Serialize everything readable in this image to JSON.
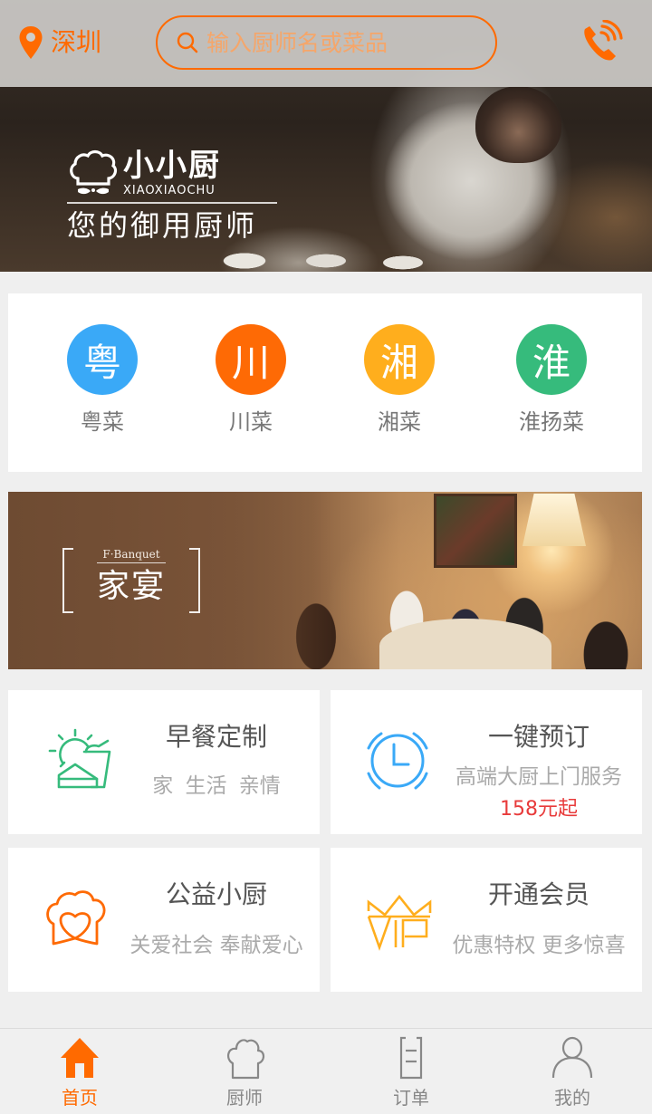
{
  "header": {
    "city": "深圳",
    "search_placeholder": "输入厨师名或菜品",
    "accent_color": "#ff6a00",
    "icons": {
      "location": "location-pin-icon",
      "search": "search-icon",
      "phone": "phone-icon"
    }
  },
  "hero": {
    "brand_name": "小小厨",
    "brand_pinyin": "XIAOXIAOCHU",
    "tagline": "您的御用厨师"
  },
  "cuisines": [
    {
      "char": "粤",
      "label": "粤菜",
      "color": "#3aa9f7"
    },
    {
      "char": "川",
      "label": "川菜",
      "color": "#fe6a05"
    },
    {
      "char": "湘",
      "label": "湘菜",
      "color": "#ffae1d"
    },
    {
      "char": "淮",
      "label": "淮扬菜",
      "color": "#36bb7c"
    }
  ],
  "banquet": {
    "en_label": "F·Banquet",
    "cn_label": "家宴"
  },
  "services": [
    {
      "title": "早餐定制",
      "subtitle": "家  生活  亲情",
      "icon": "breakfast-icon",
      "color": "#36bb7c"
    },
    {
      "title": "一键预订",
      "subtitle": "高端大厨上门服务",
      "price": "158元起",
      "icon": "clock-icon",
      "color": "#3aa9f7"
    },
    {
      "title": "公益小厨",
      "subtitle": "关爱社会 奉献爱心",
      "icon": "chef-hat-heart-icon",
      "color": "#fe6a05"
    },
    {
      "title": "开通会员",
      "subtitle": "优惠特权 更多惊喜",
      "icon": "vip-crown-icon",
      "color": "#ffae1d"
    }
  ],
  "bottom_nav": {
    "active_index": 0,
    "items": [
      {
        "label": "首页",
        "icon": "home-icon"
      },
      {
        "label": "厨师",
        "icon": "chef-hat-icon"
      },
      {
        "label": "订单",
        "icon": "order-list-icon"
      },
      {
        "label": "我的",
        "icon": "user-icon"
      }
    ]
  }
}
